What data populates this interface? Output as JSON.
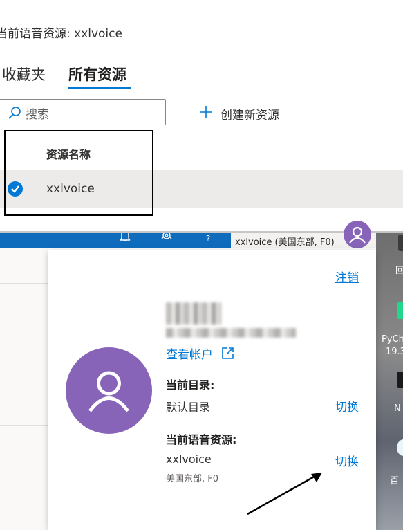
{
  "top": {
    "current_resource": "当前语音资源: xxlvoice",
    "tabs": [
      {
        "label": "收藏夹",
        "selected": false
      },
      {
        "label": "所有资源",
        "selected": true
      }
    ],
    "search": {
      "placeholder": "搜索"
    },
    "create_new": "创建新资源",
    "list": {
      "header": "资源名称",
      "rows": [
        {
          "name": "xxlvoice",
          "checked": true
        }
      ]
    }
  },
  "header_bar": {
    "account_label": "xxlvoice (美国东部, F0)",
    "help_glyph": "?"
  },
  "account_panel": {
    "logout": "注销",
    "view_account": "查看帐户",
    "current_directory_label": "当前目录:",
    "current_directory_value": "默认目录",
    "switch_label": "切换",
    "current_speech_resource_label": "当前语音资源:",
    "resource_name": "xxlvoice",
    "resource_detail": "美国东部, F0"
  },
  "desktop": {
    "labels": [
      "PyCh",
      "19.3",
      "N",
      "百"
    ]
  },
  "colors": {
    "accent": "#0078d4",
    "avatar": "#8764b8",
    "header_blue": "#0f6cbd"
  }
}
